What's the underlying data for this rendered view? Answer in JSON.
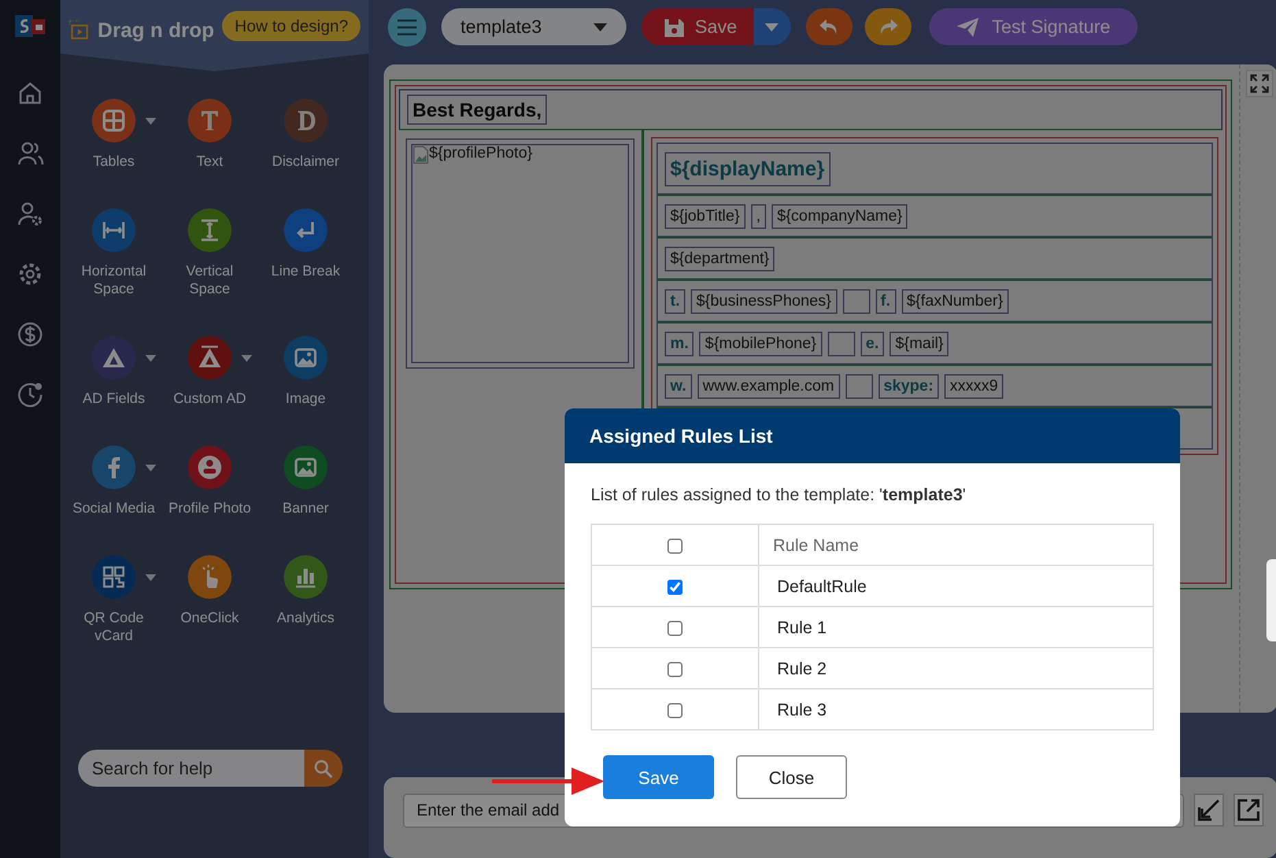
{
  "sidebar": {
    "title": "Drag n drop",
    "help_button": "How to design?",
    "tools": [
      {
        "label": "Tables",
        "has_menu": true
      },
      {
        "label": "Text",
        "has_menu": false
      },
      {
        "label": "Disclaimer",
        "has_menu": false
      },
      {
        "label": "Horizontal Space",
        "has_menu": false
      },
      {
        "label": "Vertical Space",
        "has_menu": false
      },
      {
        "label": "Line Break",
        "has_menu": false
      },
      {
        "label": "AD Fields",
        "has_menu": true
      },
      {
        "label": "Custom AD",
        "has_menu": true
      },
      {
        "label": "Image",
        "has_menu": false
      },
      {
        "label": "Social Media",
        "has_menu": true
      },
      {
        "label": "Profile Photo",
        "has_menu": false
      },
      {
        "label": "Banner",
        "has_menu": false
      },
      {
        "label": "QR Code vCard",
        "has_menu": true
      },
      {
        "label": "OneClick",
        "has_menu": false
      },
      {
        "label": "Analytics",
        "has_menu": false
      }
    ],
    "search": {
      "placeholder": "Search for help"
    }
  },
  "toolbar": {
    "template": "template3",
    "save": "Save",
    "test": "Test Signature"
  },
  "signature": {
    "greeting": "Best Regards,",
    "photo": "${profilePhoto}",
    "name": "${displayName}",
    "rows": [
      {
        "fields": [
          {
            "kind": "value",
            "text": "${jobTitle}"
          },
          {
            "kind": "value",
            "text": ","
          },
          {
            "kind": "value",
            "text": "${companyName}"
          }
        ]
      },
      {
        "fields": [
          {
            "kind": "value",
            "text": "${department}"
          }
        ]
      },
      {
        "fields": [
          {
            "kind": "label",
            "text": "t."
          },
          {
            "kind": "value",
            "text": "${businessPhones}"
          },
          {
            "kind": "blank"
          },
          {
            "kind": "label",
            "text": "f."
          },
          {
            "kind": "value",
            "text": "${faxNumber}"
          }
        ]
      },
      {
        "fields": [
          {
            "kind": "label",
            "text": "m."
          },
          {
            "kind": "value",
            "text": "${mobilePhone}"
          },
          {
            "kind": "blank"
          },
          {
            "kind": "label",
            "text": "e."
          },
          {
            "kind": "value",
            "text": "${mail}"
          }
        ]
      },
      {
        "fields": [
          {
            "kind": "label",
            "text": "w."
          },
          {
            "kind": "value",
            "text": "www.example.com"
          },
          {
            "kind": "blank"
          },
          {
            "kind": "label",
            "text": "skype:"
          },
          {
            "kind": "value",
            "text": "xxxxx9"
          }
        ]
      }
    ]
  },
  "preview": {
    "placeholder": "Enter the email add"
  },
  "modal": {
    "title": "Assigned Rules List",
    "intro": "List of rules assigned to the template: '**template3**'",
    "header": {
      "checked": false,
      "label": "Rule Name"
    },
    "rules": [
      {
        "name": "DefaultRule",
        "checked": true
      },
      {
        "name": "Rule 1",
        "checked": false
      },
      {
        "name": "Rule 2",
        "checked": false
      },
      {
        "name": "Rule 3",
        "checked": false
      }
    ],
    "buttons": [
      {
        "label": "Save",
        "kind": "primary"
      },
      {
        "label": "Close",
        "kind": "secondary"
      }
    ]
  }
}
